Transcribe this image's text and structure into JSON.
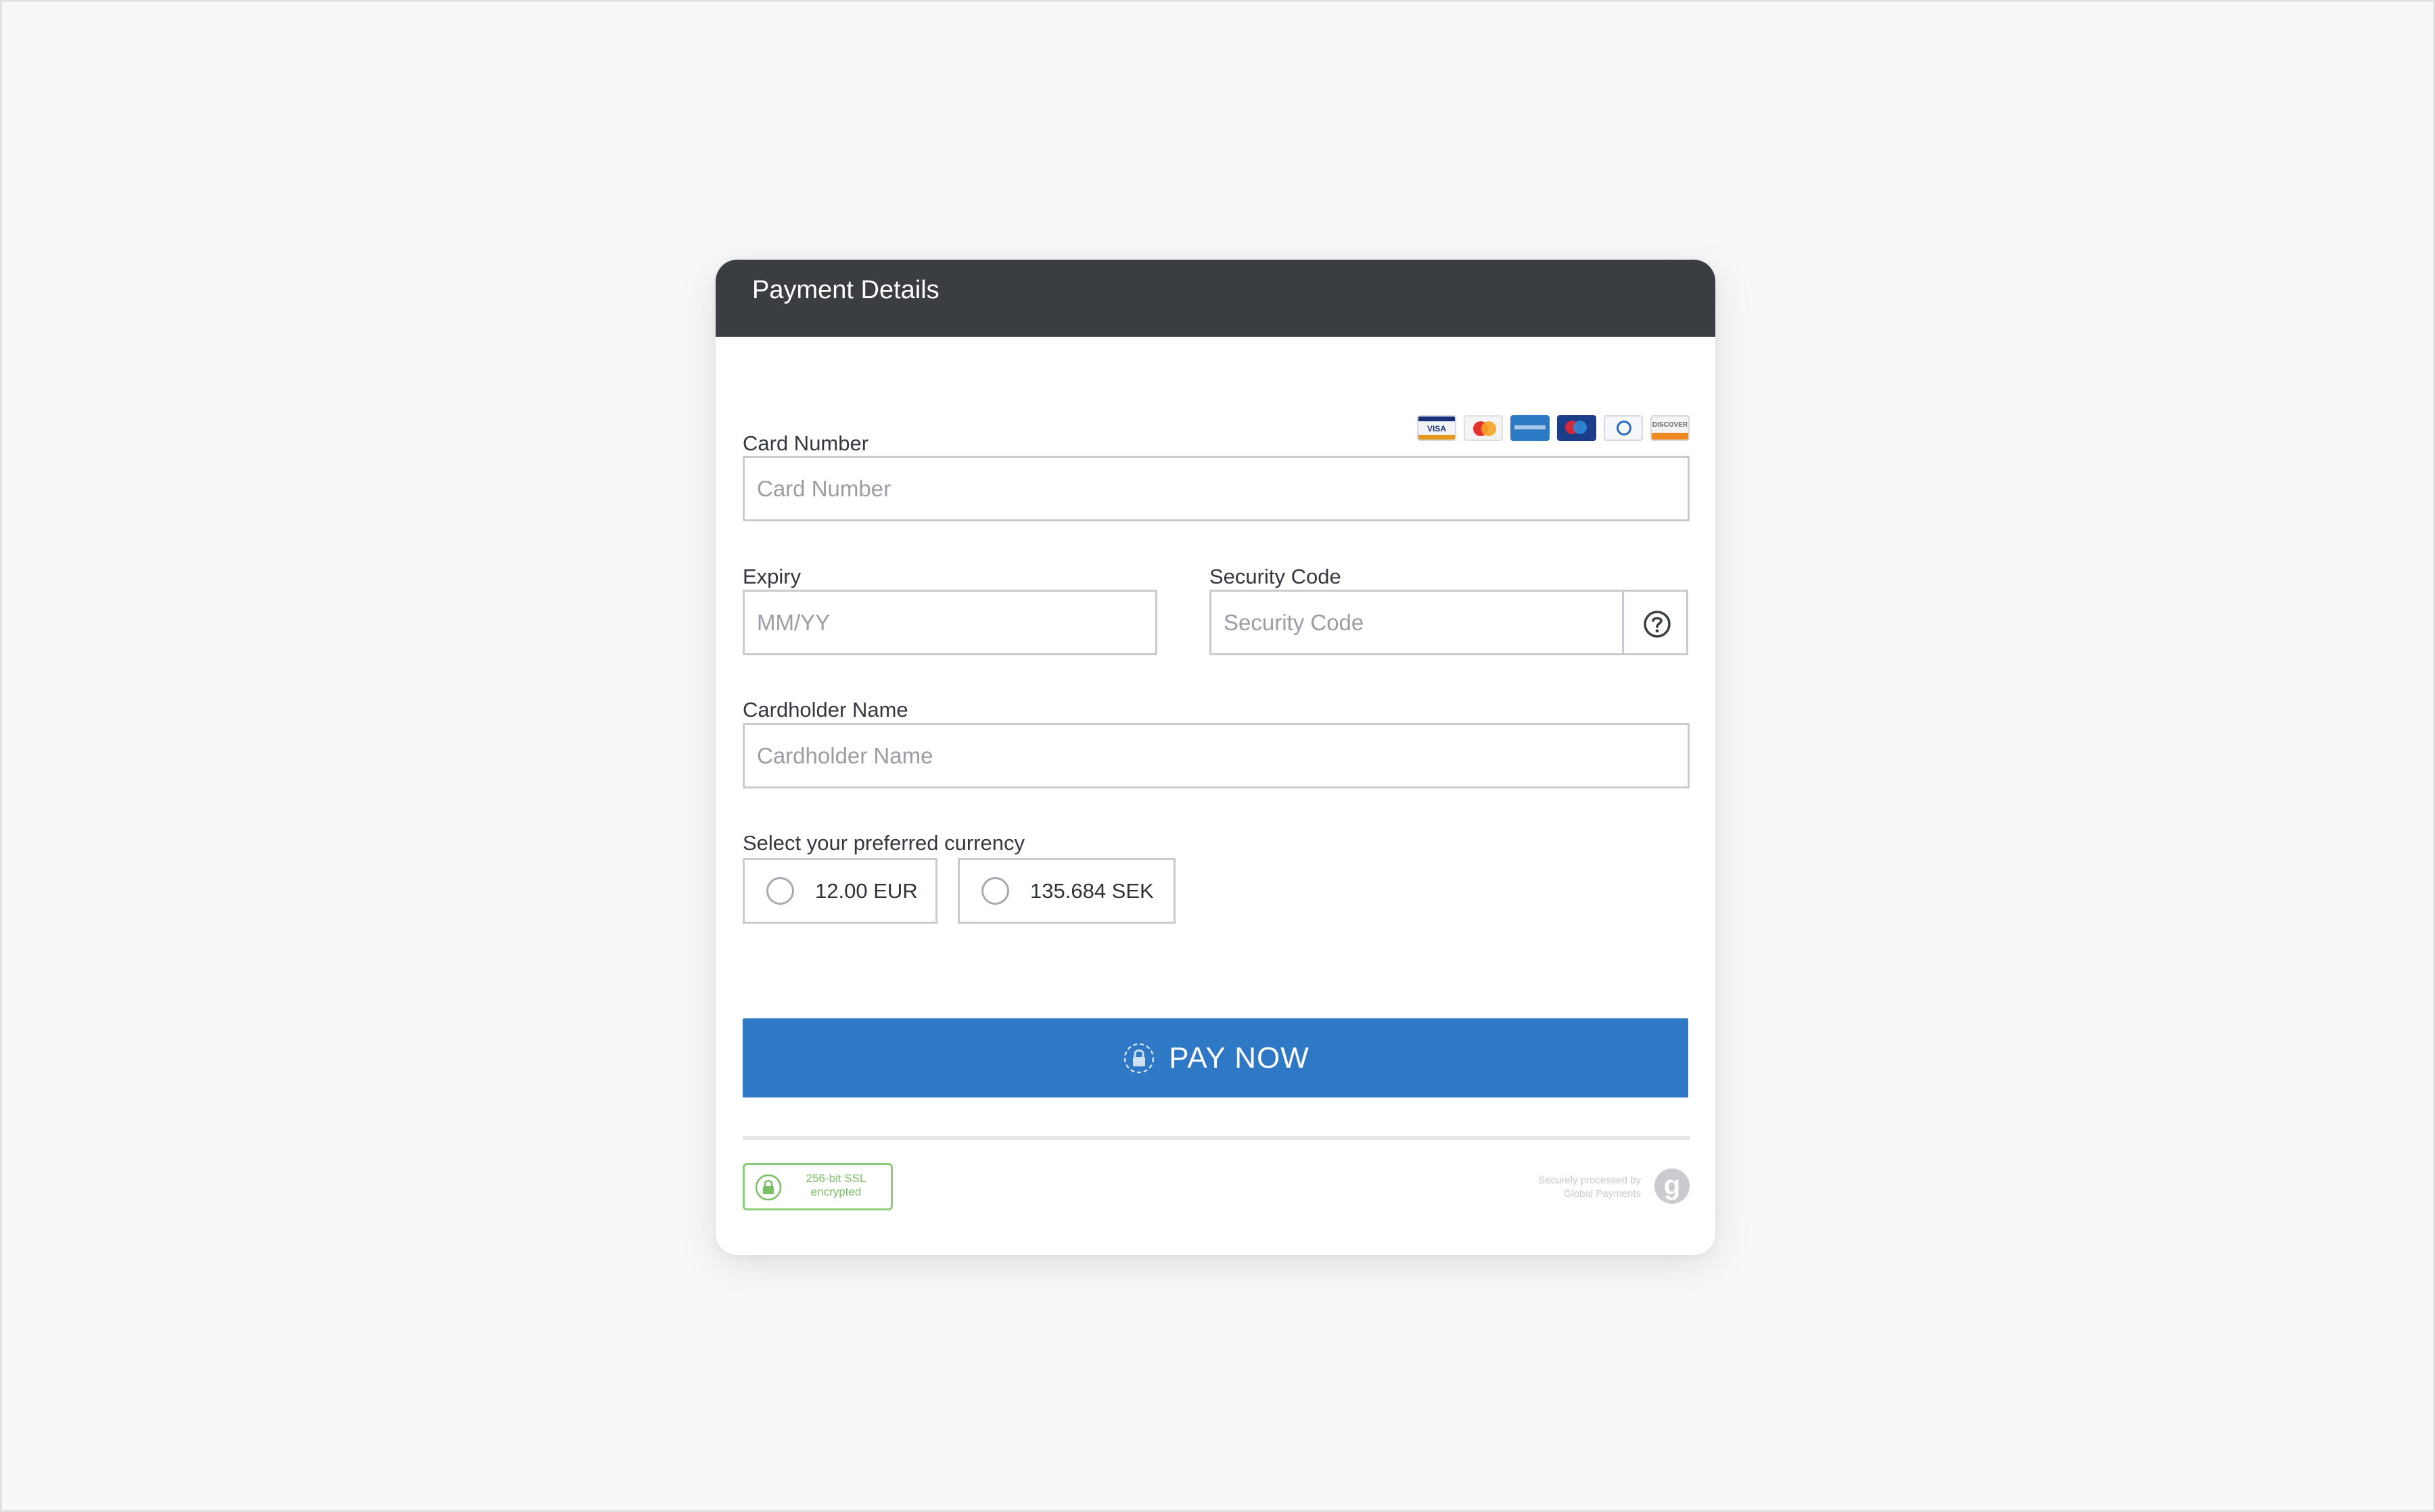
{
  "header": {
    "title": "Payment Details"
  },
  "card_number": {
    "label": "Card Number",
    "placeholder": "Card Number",
    "accepted_cards": [
      "visa-logo",
      "mastercard-logo",
      "amex-logo",
      "maestro-logo",
      "diners-logo",
      "discover-logo"
    ]
  },
  "expiry": {
    "label": "Expiry",
    "placeholder": "MM/YY"
  },
  "security_code": {
    "label": "Security Code",
    "placeholder": "Security Code",
    "help_icon": "question-circle-icon"
  },
  "cardholder": {
    "label": "Cardholder Name",
    "placeholder": "Cardholder Name"
  },
  "currency": {
    "label": "Select your preferred currency",
    "options": [
      {
        "label": "12.00 EUR",
        "selected": false
      },
      {
        "label": "135.684 SEK",
        "selected": false
      }
    ]
  },
  "pay_button": {
    "label": "PAY NOW",
    "icon": "secure-lock-icon",
    "color": "#2e78c6"
  },
  "footer": {
    "ssl_badge": {
      "line1": "256-bit SSL",
      "line2": "encrypted",
      "color": "#7abf63"
    },
    "processed_by": {
      "line1": "Securely processed by",
      "line2": "Global Payments"
    },
    "brand_logo_letter": "g"
  },
  "colors": {
    "header_bg": "#3a3d42",
    "page_bg": "#f8f8f8",
    "input_border": "#c9cbd1"
  }
}
